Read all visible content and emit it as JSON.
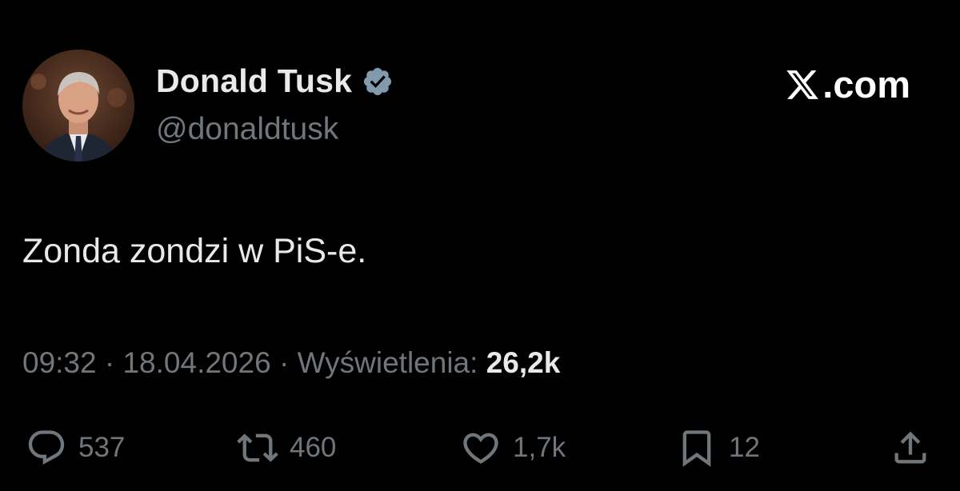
{
  "author": {
    "display_name": "Donald Tusk",
    "handle": "@donaldtusk",
    "verified": true,
    "avatar_icon": "profile-photo"
  },
  "brand": {
    "icon": "x-logo-icon",
    "text": ".com"
  },
  "tweet": {
    "text": "Zonda zondzi w PiS-e."
  },
  "meta": {
    "time": "09:32",
    "separator": "·",
    "date": "18.04.2026",
    "views_label": "Wyświetlenia:",
    "views_count": "26,2k"
  },
  "actions": {
    "reply": {
      "icon": "reply-icon",
      "count": "537"
    },
    "retweet": {
      "icon": "retweet-icon",
      "count": "460"
    },
    "like": {
      "icon": "heart-icon",
      "count": "1,7k"
    },
    "bookmark": {
      "icon": "bookmark-icon",
      "count": "12"
    },
    "share": {
      "icon": "share-icon"
    }
  },
  "colors": {
    "background": "#000000",
    "primary_text": "#e7e9ea",
    "secondary_text": "#71767b",
    "verified_badge": "#829aab"
  }
}
